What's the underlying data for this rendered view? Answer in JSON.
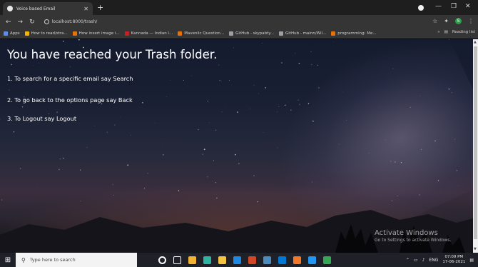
{
  "browser": {
    "tab_title": "Voice based Email",
    "new_tab": "+",
    "url": "localhost:8000/trash/",
    "window_controls": [
      "—",
      "❐",
      "✕"
    ],
    "extension_badge": "S",
    "bookmarks": [
      {
        "label": "Apps",
        "color": "#5b8def"
      },
      {
        "label": "How to read/stra...",
        "color": "#f4b400"
      },
      {
        "label": "How insert image i...",
        "color": "#e8710a"
      },
      {
        "label": "Kannada — Indian l...",
        "color": "#c5221f"
      },
      {
        "label": "Mavenlic Question...",
        "color": "#e8710a"
      },
      {
        "label": "GitHub - skypabty...",
        "color": "#9aa0a6"
      },
      {
        "label": "GitHub - mainn/Wil...",
        "color": "#9aa0a6"
      },
      {
        "label": "programming: Me...",
        "color": "#e8710a"
      }
    ],
    "bookmarks_more": "»",
    "reading_list": "Reading list"
  },
  "page": {
    "heading": "You have reached your Trash folder.",
    "instructions": [
      "1. To search for a specific email say Search",
      "2. To go back to the options page say Back",
      "3. To Logout say Logout"
    ]
  },
  "watermark": {
    "line1": "Activate Windows",
    "line2": "Go to Settings to activate Windows."
  },
  "taskbar": {
    "search_placeholder": "Type here to search",
    "apps": [
      {
        "name": "cortana-icon",
        "color": "#ffffff"
      },
      {
        "name": "task-view-icon",
        "color": "#ffffff"
      },
      {
        "name": "store-icon",
        "color": "#f2b233"
      },
      {
        "name": "edge-icon",
        "color": "#2fb3a1"
      },
      {
        "name": "explorer-icon",
        "color": "#f5c342"
      },
      {
        "name": "mail-icon",
        "color": "#1e88e5"
      },
      {
        "name": "powerpoint-icon",
        "color": "#d24726"
      },
      {
        "name": "python-icon",
        "color": "#4b8bbe"
      },
      {
        "name": "vscode-icon",
        "color": "#0078d4"
      },
      {
        "name": "jupyter-icon",
        "color": "#f37726"
      },
      {
        "name": "visual-studio-icon",
        "color": "#2196f3"
      },
      {
        "name": "chrome-icon",
        "color": "#34a853"
      }
    ],
    "lang": "ENG",
    "time": "07:09 PM",
    "date": "17-06-2021"
  }
}
